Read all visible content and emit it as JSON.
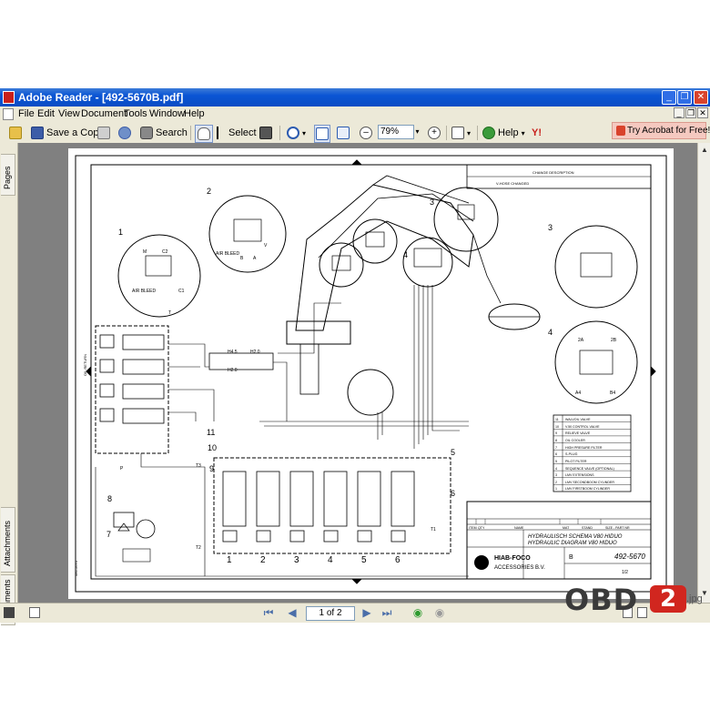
{
  "window": {
    "title": "Adobe Reader - [492-5670B.pdf]",
    "controls": [
      "_",
      "❐",
      "✕"
    ]
  },
  "menubar": {
    "items": [
      "File",
      "Edit",
      "View",
      "Document",
      "Tools",
      "Window",
      "Help"
    ],
    "doc_controls": [
      "_",
      "❐",
      "✕"
    ]
  },
  "toolbar": {
    "save_copy": "Save a Copy",
    "search": "Search",
    "select": "Select",
    "zoom": "79%",
    "help": "Help",
    "try_acrobat": "Try Acrobat for Free!"
  },
  "side_tabs": {
    "pages": "Pages",
    "attachments": "Attachments",
    "comments": "Comments"
  },
  "status": {
    "page_indicator": "1 of 2"
  },
  "document": {
    "callouts": [
      "1",
      "2",
      "3",
      "3",
      "4",
      "4",
      "5",
      "6",
      "7",
      "8",
      "9",
      "10",
      "11"
    ],
    "labels": {
      "air_bleed_1": "AIR BLEED",
      "air_bleed_2": "AIR BLEED",
      "c1": "C1",
      "c2": "C2",
      "m": "M",
      "v": "V",
      "a": "A",
      "b": "B",
      "t": "T",
      "p": "P",
      "port_2a": "2A",
      "port_2b": "2B",
      "port_a4": "A4",
      "port_b4": "B4"
    },
    "section_numbers": [
      "1",
      "2",
      "3",
      "4",
      "5",
      "6"
    ],
    "legend": [
      {
        "no": "11",
        "text": "WALVOIL VALVE"
      },
      {
        "no": "10",
        "text": "V.50 CONTROL VALVE"
      },
      {
        "no": "9",
        "text": "RELIEVE VALVE"
      },
      {
        "no": "8",
        "text": "OIL COOLER"
      },
      {
        "no": "7",
        "text": "HIGH PRESURE FILTER"
      },
      {
        "no": "6",
        "text": "S-PLUG"
      },
      {
        "no": "5",
        "text": "PILOT FILTER"
      },
      {
        "no": "4",
        "text": "SEQUENCE VALVE (OPTIONAL)"
      },
      {
        "no": "3",
        "text": "LMV EXTENSIONS"
      },
      {
        "no": "2",
        "text": "LMV SECONDBOOM CYLINDER"
      },
      {
        "no": "1",
        "text": "LMV FIRSTBOOM CYLINDER"
      }
    ],
    "title_block": {
      "col_item": "ITEM",
      "col_qty": "QTY",
      "col_name": "NAME",
      "col_mat": "MAT",
      "col_stand": "STAND",
      "col_part": "SIZE - PART NR",
      "title_nl": "HYDRAULISCH SCHEMA V80 HIDUO",
      "title_en": "HYDRAULIC DIAGRAM V80 HIDUO",
      "company": "HIAB-FOCO",
      "company_sub": "ACCESSORIES B.V.",
      "drawing_no": "492-5670",
      "drawing_suffix": "B",
      "sheet": "1/2"
    },
    "revision_header": "CHANGE DESCRIPTION",
    "revision_row": "V-HOSE CHANGED",
    "hydraulic_labels": {
      "oil_return": "OIL RETURN",
      "diagram_labels": [
        "H4.5",
        "H2.0",
        "H2.0"
      ],
      "port_t1": "T1",
      "port_t2": "T2",
      "port_t3": "T3"
    }
  },
  "watermark": {
    "brand": "OBD",
    "number": "2",
    "suffix": ".jpg"
  }
}
